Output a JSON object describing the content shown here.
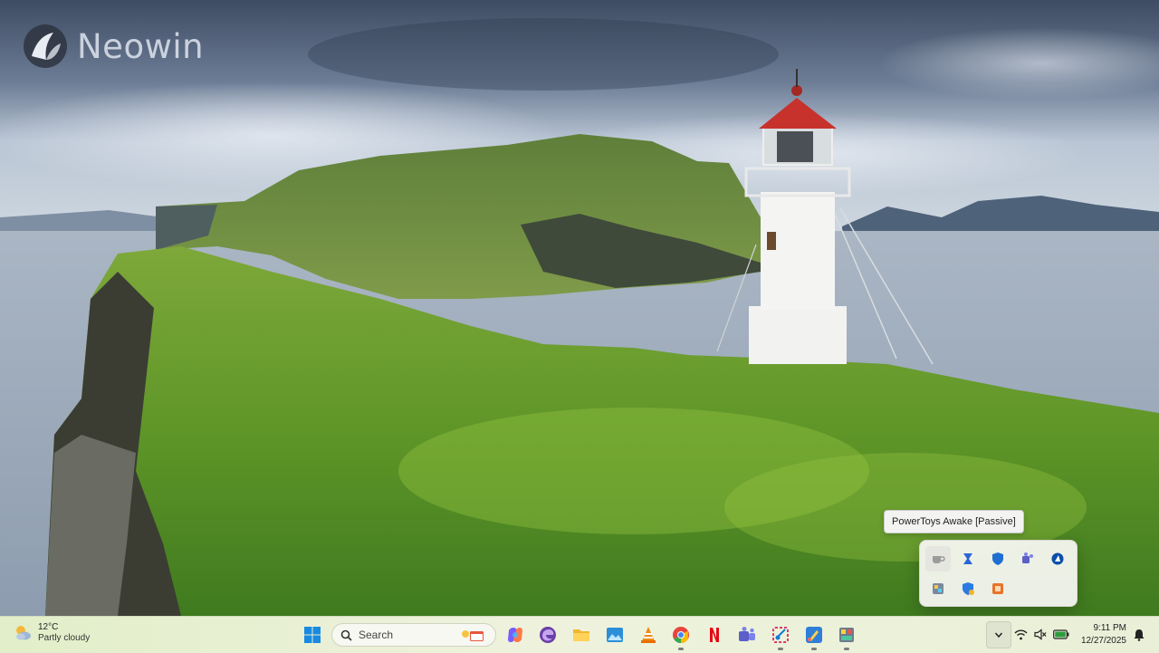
{
  "watermark": {
    "brand": "Neowin"
  },
  "tooltip": {
    "text": "PowerToys Awake [Passive]"
  },
  "flyout": {
    "icons": [
      "powertoys-awake-icon",
      "power-automate-icon",
      "defender-icon",
      "teams-icon",
      "azure-vpn-icon",
      "settings-app-icon",
      "windows-security-icon",
      "orange-app-icon"
    ]
  },
  "weather": {
    "temp": "12°C",
    "condition": "Partly cloudy"
  },
  "search": {
    "placeholder": "Search"
  },
  "taskbar": {
    "pinned": [
      "start-icon",
      "copilot-icon",
      "edge-dev-icon",
      "file-explorer-icon",
      "photos-icon",
      "vlc-icon",
      "chrome-icon",
      "netflix-icon",
      "teams-icon",
      "snipping-tool-icon",
      "paint-icon",
      "app-icon"
    ]
  },
  "tray": {
    "icons": [
      "wifi-icon",
      "speaker-muted-icon",
      "battery-icon"
    ]
  },
  "clock": {
    "time": "9:11 PM",
    "date": "12/27/2025"
  }
}
